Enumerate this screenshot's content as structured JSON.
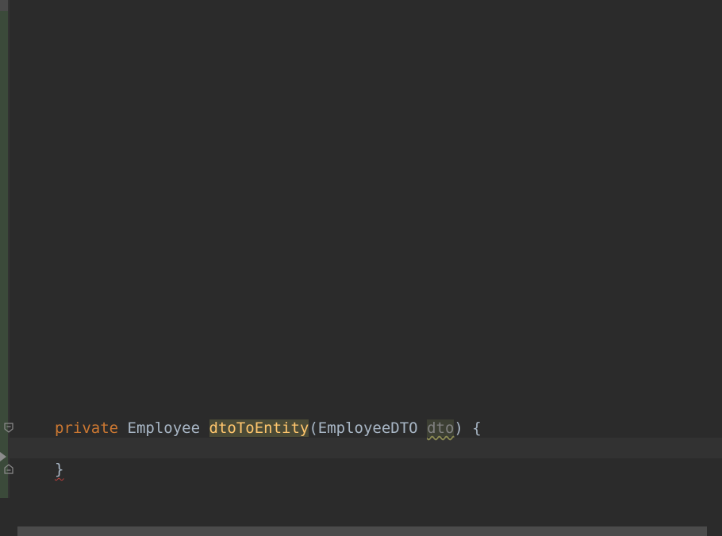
{
  "code": {
    "line1": {
      "keyword": "private",
      "return_type": "Employee",
      "method_name": "dtoToEntity",
      "open_paren": "(",
      "param_type": "EmployeeDTO",
      "param_name": "dto",
      "close_paren_brace": ") {"
    },
    "line3": {
      "closing_brace": "}"
    }
  },
  "colors": {
    "background": "#2b2b2b",
    "keyword": "#cc7832",
    "method": "#ffc66d",
    "text": "#a9b7c6",
    "unused_param": "#808080"
  }
}
